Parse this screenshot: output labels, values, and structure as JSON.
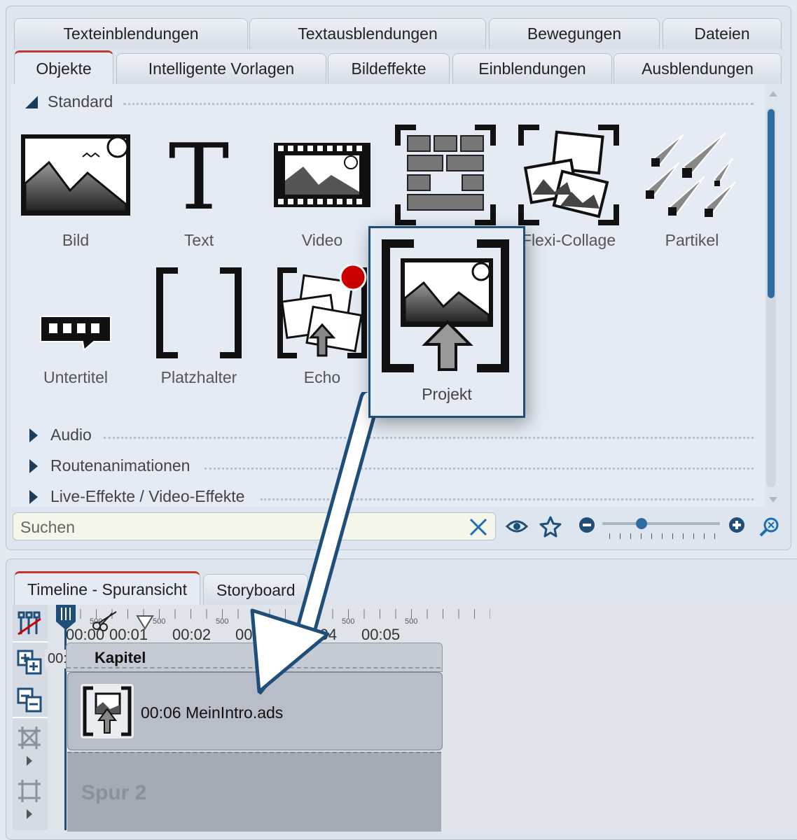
{
  "tabs_row1": [
    "Texteinblendungen",
    "Textausblendungen",
    "Bewegungen",
    "Dateien"
  ],
  "tabs_row2": [
    "Objekte",
    "Intelligente Vorlagen",
    "Bildeffekte",
    "Einblendungen",
    "Ausblendungen"
  ],
  "active_tab": "Objekte",
  "sections": {
    "standard": "Standard",
    "audio": "Audio",
    "routen": "Routenanimationen",
    "live": "Live-Effekte / Video-Effekte"
  },
  "objects": [
    {
      "label": "Bild",
      "icon": "image-icon"
    },
    {
      "label": "Text",
      "icon": "text-icon"
    },
    {
      "label": "Video",
      "icon": "video-icon"
    },
    {
      "label": "",
      "icon": "collage-grid-icon"
    },
    {
      "label": "Flexi-Collage",
      "icon": "flexi-collage-icon"
    },
    {
      "label": "Partikel",
      "icon": "particle-icon"
    },
    {
      "label": "Untertitel",
      "icon": "subtitle-icon"
    },
    {
      "label": "Platzhalter",
      "icon": "placeholder-icon"
    },
    {
      "label": "Echo",
      "icon": "echo-icon"
    }
  ],
  "drag_item": {
    "label": "Projekt",
    "icon": "project-icon"
  },
  "search": {
    "placeholder": "Suchen"
  },
  "bottom_tabs": [
    "Timeline - Spuransicht",
    "Storyboard"
  ],
  "ruler": {
    "times": [
      "00:00",
      "00:01",
      "00:02",
      "00:03",
      "00:04",
      "00:05"
    ],
    "sub_label": "500"
  },
  "timeline": {
    "start_time": "00:00",
    "chapter": "Kapitel",
    "clip": "00:06 MeinIntro.ads",
    "track2": "Spur 2"
  },
  "colors": {
    "accent": "#1f4e79",
    "active_tab_top": "#c0392b",
    "record_dot": "#cc0000"
  }
}
